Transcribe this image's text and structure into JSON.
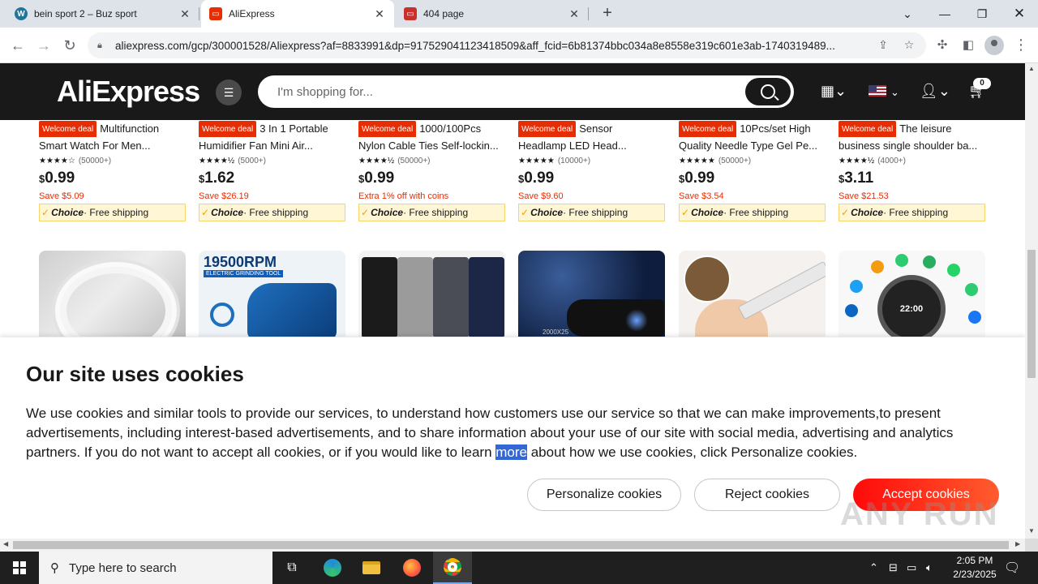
{
  "browser": {
    "tabs": [
      {
        "title": "bein sport 2 – Buz sport",
        "favicon": "wordpress-icon",
        "active": false
      },
      {
        "title": "AliExpress",
        "favicon": "aliexpress-icon",
        "active": true
      },
      {
        "title": "404 page",
        "favicon": "page-icon",
        "active": false
      }
    ],
    "new_tab_label": "+",
    "url": "aliexpress.com/gcp/300001528/Aliexpress?af=8833991&dp=917529041123418509&aff_fcid=6b81374bbc034a8e8558e319c601e3ab-1740319489..."
  },
  "site": {
    "logo": "AliExpress",
    "search_placeholder": "I'm shopping for...",
    "cart_count": "0"
  },
  "products_row1": [
    {
      "badge": "Welcome deal",
      "title1": "Multifunction",
      "title2": "Smart Watch For Men...",
      "stars": "★★★★☆",
      "reviews": "(50000+)",
      "currency": "$",
      "price": "0.99",
      "save": "Save $5.09",
      "choice": "Choice",
      "shipping": "· Free shipping"
    },
    {
      "badge": "Welcome deal",
      "title1": "3 In 1 Portable",
      "title2": "Humidifier Fan Mini Air...",
      "stars": "★★★★½",
      "reviews": "(5000+)",
      "currency": "$",
      "price": "1.62",
      "save": "Save $26.19",
      "choice": "Choice",
      "shipping": "· Free shipping"
    },
    {
      "badge": "Welcome deal",
      "title1": "1000/100Pcs",
      "title2": "Nylon Cable Ties Self-lockin...",
      "stars": "★★★★½",
      "reviews": "(50000+)",
      "currency": "$",
      "price": "0.99",
      "save": "Extra 1% off with coins",
      "choice": "Choice",
      "shipping": "· Free shipping"
    },
    {
      "badge": "Welcome deal",
      "title1": "Sensor",
      "title2": "Headlamp LED Head...",
      "stars": "★★★★★",
      "reviews": "(10000+)",
      "currency": "$",
      "price": "0.99",
      "save": "Save $9.60",
      "choice": "Choice",
      "shipping": "· Free shipping"
    },
    {
      "badge": "Welcome deal",
      "title1": "10Pcs/set High",
      "title2": "Quality Needle Type Gel Pe...",
      "stars": "★★★★★",
      "reviews": "(50000+)",
      "currency": "$",
      "price": "0.99",
      "save": "Save $3.54",
      "choice": "Choice",
      "shipping": "· Free shipping"
    },
    {
      "badge": "Welcome deal",
      "title1": "The leisure",
      "title2": "business single shoulder ba...",
      "stars": "★★★★½",
      "reviews": "(4000+)",
      "currency": "$",
      "price": "3.11",
      "save": "Save $21.53",
      "choice": "Choice",
      "shipping": "· Free shipping"
    }
  ],
  "product_images_row2": {
    "grinder_text": "19500RPM",
    "grinder_sub": "ELECTRIC GRINDING TOOL",
    "monocular_text": "2000X25",
    "watch_time": "22:00"
  },
  "cookie_banner": {
    "title": "Our site uses cookies",
    "text_before": "We use cookies and similar tools to provide our services, to understand how customers use our service so that we can make improvements,to present advertisements, including interest-based advertisements, and to share information about your use of our site with social media, advertising and analytics partners. If you do not want to accept all cookies, or if you would like to learn ",
    "text_highlight": "more",
    "text_after": " about how we use cookies, click Personalize cookies.",
    "btn_personalize": "Personalize cookies",
    "btn_reject": "Reject cookies",
    "btn_accept": "Accept cookies"
  },
  "watermark": "ANY RUN",
  "taskbar": {
    "search_placeholder": "Type here to search",
    "time": "2:05 PM",
    "date": "2/23/2025"
  },
  "colors": {
    "ali_red": "#e62e04",
    "header_bg": "#191919",
    "accept_gradient_start": "#ff0a0a",
    "accept_gradient_end": "#ff5c2e",
    "highlight": "#3367d6"
  }
}
